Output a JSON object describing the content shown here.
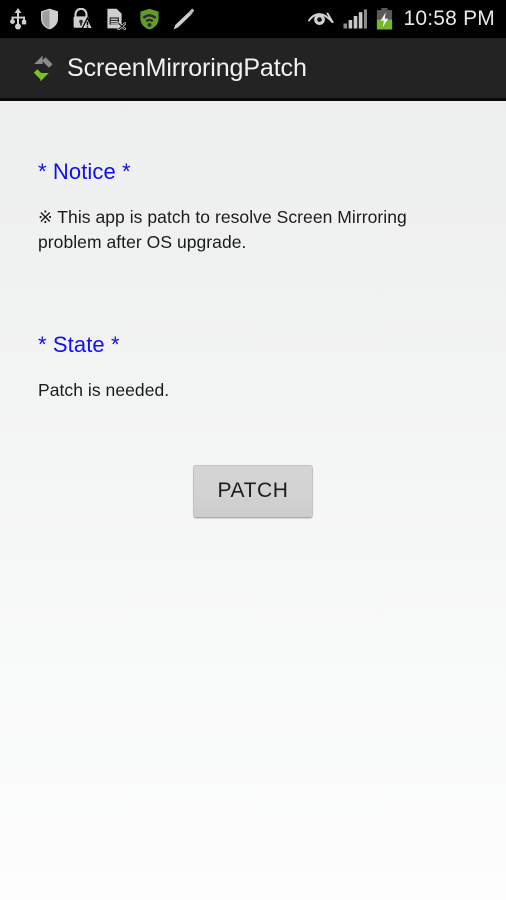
{
  "status_bar": {
    "background_color": "#000000",
    "time": "10:58 PM",
    "left_icons": [
      {
        "name": "usb-icon",
        "label": "USB connected"
      },
      {
        "name": "shield-icon",
        "label": "Security shield"
      },
      {
        "name": "lock-warning-icon",
        "label": "Lock with warning"
      },
      {
        "name": "sim-card-error-icon",
        "label": "SIM card removed"
      },
      {
        "name": "secure-wifi-icon",
        "label": "Secure Wi-Fi",
        "color": "#6aa32c"
      },
      {
        "name": "stylus-pen-icon",
        "label": "S Pen detached"
      }
    ],
    "right_icons": [
      {
        "name": "smart-stay-eye-icon",
        "label": "Smart stay"
      },
      {
        "name": "signal-bars-icon",
        "label": "Mobile signal strength"
      },
      {
        "name": "battery-charging-icon",
        "label": "Battery charging",
        "color": "#76b729"
      }
    ]
  },
  "action_bar": {
    "background_color": "#232323",
    "app_icon_name": "screen-mirroring-sync-icon",
    "title": "ScreenMirroringPatch"
  },
  "content": {
    "notice": {
      "heading": "* Notice *",
      "heading_color": "#1010ee",
      "text": "※ This app is patch to resolve Screen Mirroring problem after OS upgrade."
    },
    "state": {
      "heading": "* State *",
      "heading_color": "#1010ee",
      "text": "Patch is needed."
    },
    "patch_button_label": "PATCH"
  }
}
